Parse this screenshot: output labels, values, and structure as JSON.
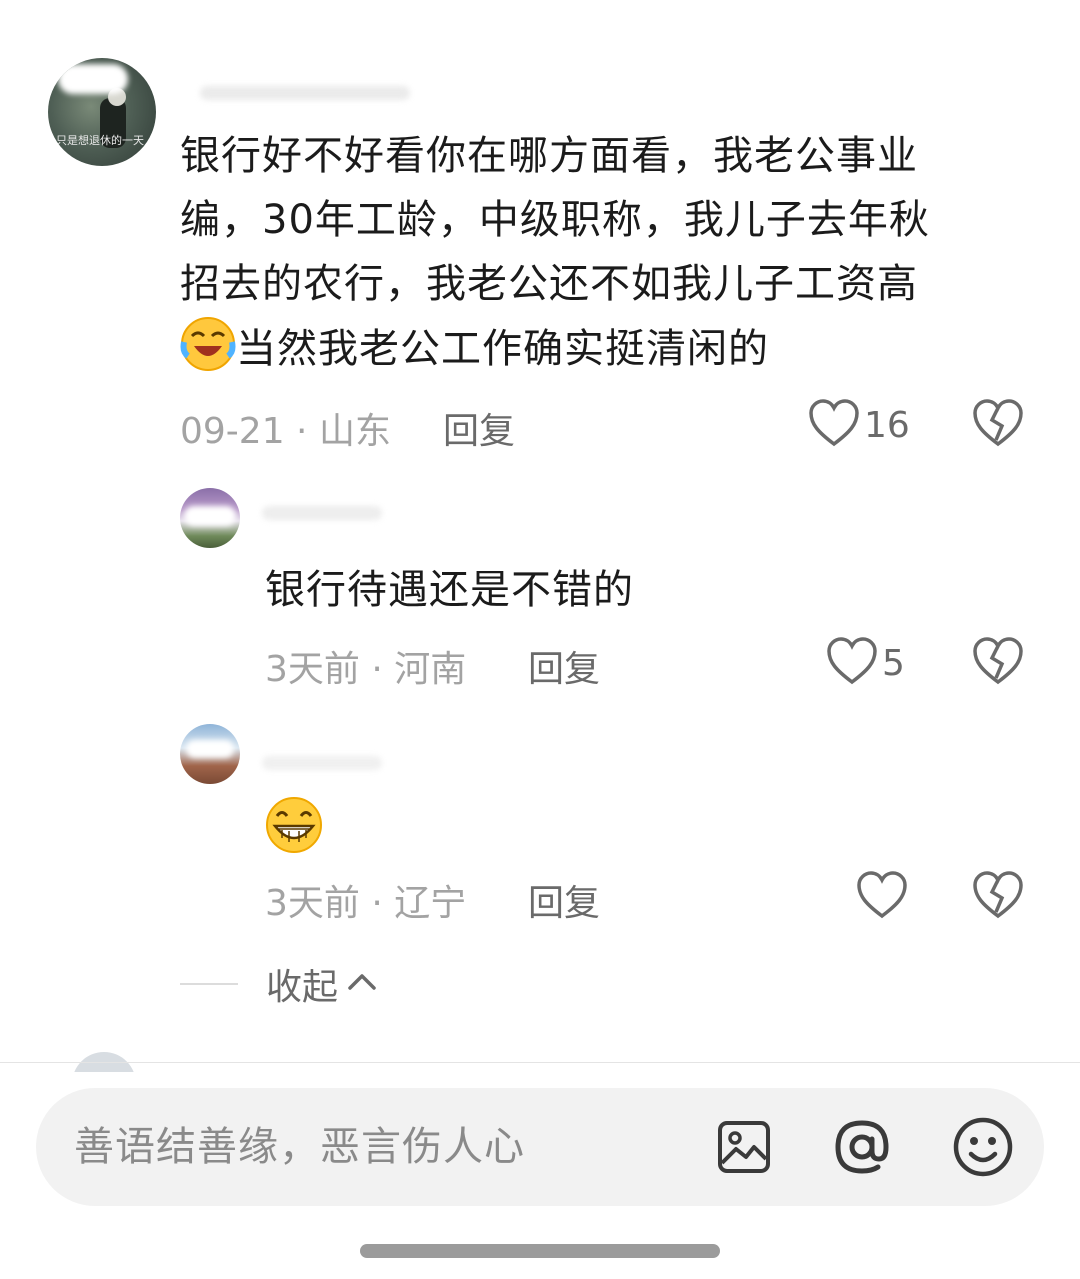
{
  "comments": [
    {
      "text_line1": "银行好不好看你在哪方面看，我老公事业",
      "text_line2": "编，30年工龄，中级职称，我儿子去年秋",
      "text_line3": "招去的农行，我老公还不如我儿子工资高",
      "text_line4": "当然我老公工作确实挺清闲的",
      "emoji": "laugh-cry-emoji",
      "meta": "09-21 · 山东",
      "reply_label": "回复",
      "likes": "16",
      "avatar_caption": "只是想退休的一天"
    },
    {
      "text": "银行待遇还是不错的",
      "meta": "3天前 · 河南",
      "reply_label": "回复",
      "likes": "5"
    },
    {
      "emoji": "grin-emoji",
      "meta": "3天前 · 辽宁",
      "reply_label": "回复",
      "likes": ""
    }
  ],
  "collapse_label": "收起",
  "input": {
    "placeholder": "善语结善缘，恶言伤人心"
  },
  "icons": {
    "like": "heart-outline-icon",
    "dislike": "broken-heart-icon",
    "image": "image-icon",
    "mention": "at-icon",
    "emoji": "smiley-icon",
    "collapse": "chevron-up-icon"
  },
  "colors": {
    "text": "#1b1b1b",
    "meta": "#a3a3a3",
    "action": "#6a6a6a",
    "input_bg": "#f2f2f2"
  }
}
